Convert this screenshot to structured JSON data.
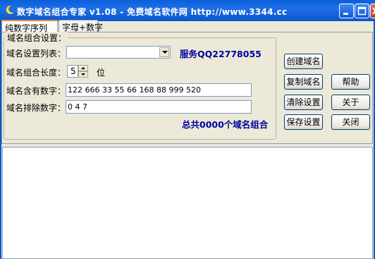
{
  "window": {
    "title": "数字域名组合专家 v1.08 - 免费域名软件网 http://www.3344.cc",
    "titlebar_color": "#0a5fd8"
  },
  "tabs": [
    {
      "label": "纯数字序列",
      "active": true
    },
    {
      "label": "字母+数字",
      "active": false
    }
  ],
  "group": {
    "legend": "域名组合设置："
  },
  "form": {
    "list_label": "域名设置列表：",
    "list_value": "",
    "length_label": "域名组合长度：",
    "length_value": "5",
    "length_unit": "位",
    "include_label": "域名含有数字：",
    "include_value": "122 666 33 55 66 168 88 999 520",
    "exclude_label": "域名排除数字：",
    "exclude_value": "0 4 7"
  },
  "service_text": "服务QQ22778055",
  "total_text": "总共0000个域名组合",
  "buttons": {
    "create": "创建域名",
    "copy": "复制域名",
    "clear": "清除设置",
    "save": "保存设置",
    "help": "帮助",
    "about": "关于",
    "close": "关闭"
  },
  "output": {
    "content": ""
  },
  "colors": {
    "accent_text": "#0000a0"
  }
}
